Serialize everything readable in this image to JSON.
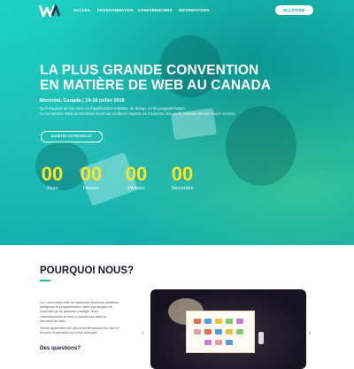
{
  "nav": {
    "items": [
      "ACCUEIL",
      "PROGRAMMATION",
      "CONFÉRENCIERS",
      "INFORMATIONS"
    ],
    "ticket_button": "BILLETERIE"
  },
  "hero": {
    "title_line1": "LA PLUS GRANDE CONVENTION",
    "title_line2": "EN MATIÈRE DE WEB AU CANADA",
    "date": "Montréal, Canada | 14-16 juillet 2018",
    "desc_line1": "Qu'il s'agisse de site web ou d'applications mobiles, de design ou de programmation,",
    "desc_line2": "la Convention Web de Montréal réunit les meilleurs experts de l'industrie afin qu'ils puissent dévoiler leurs secrets.",
    "buy_button": "ACHETEZ VOTRE BILLET",
    "countdown": [
      {
        "value": "00",
        "label": "Jours"
      },
      {
        "value": "00",
        "label": "Heures"
      },
      {
        "value": "00",
        "label": "Minutes"
      },
      {
        "value": "00",
        "label": "Secondes"
      }
    ]
  },
  "why": {
    "title": "POURQUOI NOUS?",
    "p1": "La Convention Web de Montréal réunit les meilleurs designers et programmeurs web d'Amérique du Nord afin qu'ils puissent partager leurs connaissances et leurs expériences dans le domaine du web.",
    "p2": "Venez apprendre les dernières tendances du web et trouvez l'inspiration qui vous manque!",
    "questions": "Des questions?"
  },
  "slider": {
    "prev": "‹",
    "next": "›"
  },
  "colors": {
    "accent": "#15b8ae",
    "countdown": "#ffe524"
  }
}
